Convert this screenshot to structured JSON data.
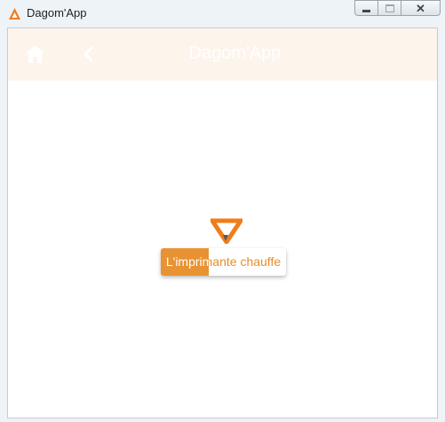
{
  "window": {
    "title": "Dagom'App",
    "controls": {
      "minimize": "minimize",
      "maximize": "maximize",
      "close": "close"
    }
  },
  "header": {
    "title": "Dagom'App",
    "home_icon": "home-icon",
    "back_icon": "chevron-left-icon"
  },
  "loading": {
    "message": "L'imprimante chauffe",
    "progress": 0.38
  },
  "colors": {
    "accent": "#e89233",
    "header_bg": "#fdf4ec",
    "header_text": "#ffffff"
  }
}
